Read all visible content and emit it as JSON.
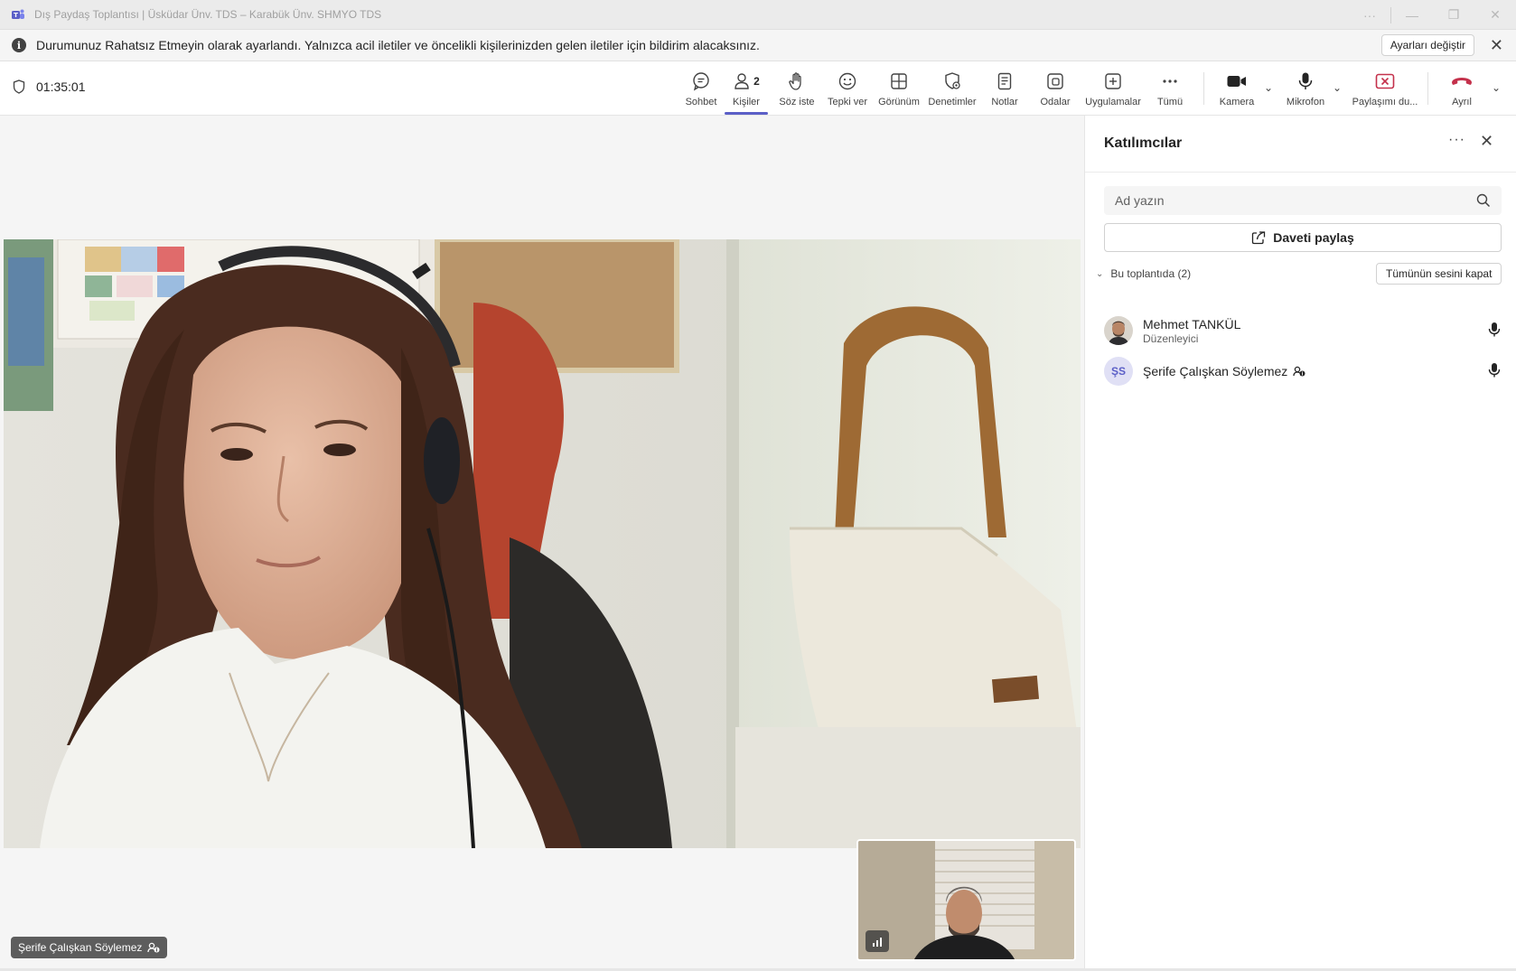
{
  "window": {
    "title": "Dış Paydaş Toplantısı | Üsküdar Ünv. TDS – Karabük Ünv. SHMYO TDS",
    "controls": [
      "more-icon",
      "minimize-icon",
      "restore-icon",
      "close-icon"
    ]
  },
  "notice": {
    "message": "Durumunuz Rahatsız Etmeyin olarak ayarlandı. Yalnızca acil iletiler ve öncelikli kişilerinizden gelen iletiler için bildirim alacaksınız.",
    "settings_label": "Ayarları değiştir",
    "close_label": "✕"
  },
  "toolbar": {
    "timer": "01:35:01",
    "items": [
      {
        "label": "Sohbet",
        "icon": "chat-icon"
      },
      {
        "label": "Kişiler",
        "icon": "people-icon",
        "count": "2",
        "active": true
      },
      {
        "label": "Söz iste",
        "icon": "raise-hand-icon"
      },
      {
        "label": "Tepki ver",
        "icon": "react-icon"
      },
      {
        "label": "Görünüm",
        "icon": "view-icon"
      },
      {
        "label": "Denetimler",
        "icon": "controls-icon"
      },
      {
        "label": "Notlar",
        "icon": "notes-icon"
      },
      {
        "label": "Odalar",
        "icon": "rooms-icon"
      },
      {
        "label": "Uygulamalar",
        "icon": "apps-icon"
      },
      {
        "label": "Tümü",
        "icon": "more-icon"
      },
      {
        "label": "Kamera",
        "icon": "camera-icon"
      },
      {
        "label": "Mikrofon",
        "icon": "mic-icon"
      },
      {
        "label": "Paylaşımı du...",
        "icon": "stop-share-icon"
      },
      {
        "label": "Ayrıl",
        "icon": "hang-up-icon"
      }
    ],
    "colors": {
      "accent": "#5b5fc7",
      "leave": "#c4314b",
      "stop_share": "#c4314b"
    }
  },
  "stage": {
    "speaker_name": "Şerife Çalışkan Söylemez"
  },
  "panel": {
    "title": "Katılımcılar",
    "more_label": "···",
    "close_label": "✕",
    "search_placeholder": "Ad yazın",
    "invite_label": "Daveti paylaş",
    "section_label": "Bu toplantıda (2)",
    "mute_all_label": "Tümünün sesini kapat",
    "participants": [
      {
        "name": "Mehmet TANKÜL",
        "role": "Düzenleyici",
        "avatar": "photo"
      },
      {
        "name": "Şerife Çalışkan Söylemez",
        "role": "",
        "initials": "ŞS",
        "anonymous_badge": true
      }
    ]
  }
}
